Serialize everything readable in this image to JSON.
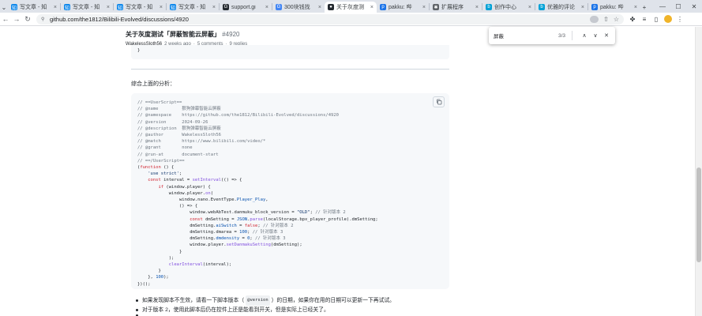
{
  "browser": {
    "tabs": [
      {
        "label": "写文章 - 知",
        "color": "#0f88eb",
        "glyph": "知"
      },
      {
        "label": "写文章 - 知",
        "color": "#0f88eb",
        "glyph": "知"
      },
      {
        "label": "写文章 - 知",
        "color": "#0f88eb",
        "glyph": "知"
      },
      {
        "label": "写文章 - 知",
        "color": "#0f88eb",
        "glyph": "知"
      },
      {
        "label": "support.gi",
        "color": "#24292f",
        "glyph": "G"
      },
      {
        "label": "300块钱找",
        "color": "#4285f4",
        "glyph": "G"
      },
      {
        "label": "关于灰度测",
        "color": "#24292f",
        "glyph": "●"
      },
      {
        "label": "pakku: 哔",
        "color": "#1a73e8",
        "glyph": "p"
      },
      {
        "label": "扩展程序",
        "color": "#5f6368",
        "glyph": "✱"
      },
      {
        "label": "创作中心",
        "color": "#00a1d6",
        "glyph": "b"
      },
      {
        "label": "优雅的评论",
        "color": "#00a1d6",
        "glyph": "b"
      },
      {
        "label": "pakku: 哔",
        "color": "#1a73e8",
        "glyph": "p"
      }
    ],
    "url": "github.com/the1812/Bilibili-Evolved/discussions/4920"
  },
  "discussion": {
    "title": "关于灰度测试「屏蔽智能云屏蔽」",
    "number": "#4920",
    "author": "WakelessSloth56",
    "time": "2 weeks ago",
    "comments": "5 comments",
    "replies": "9 replies",
    "prev_code_end": "}",
    "analysis_text": "综合上面的分析：",
    "code_lines": [
      [
        [
          "c-cm",
          "// ==UserScript=="
        ]
      ],
      [
        [
          "c-cm",
          "// @name         狠狗弹幕智能云屏蔽"
        ]
      ],
      [
        [
          "c-cm",
          "// @namespace    https://github.com/the1812/Bilibili-Evolved/discussions/4920"
        ]
      ],
      [
        [
          "c-cm",
          "// @version      2024-09-26"
        ]
      ],
      [
        [
          "c-cm",
          "// @description  狠狗弹幕智能云屏蔽"
        ]
      ],
      [
        [
          "c-cm",
          "// @author       WakelessSloth56"
        ]
      ],
      [
        [
          "c-cm",
          "// @match        https://www.bilibili.com/video/*"
        ]
      ],
      [
        [
          "c-cm",
          "// @grant        none"
        ]
      ],
      [
        [
          "c-cm",
          "// @run-at       document-start"
        ]
      ],
      [
        [
          "c-cm",
          "// ==/UserScript=="
        ]
      ],
      [
        [
          "",
          "("
        ],
        [
          "c-kw",
          "function"
        ],
        [
          "",
          " () {"
        ]
      ],
      [
        [
          "",
          "    "
        ],
        [
          "c-str",
          "'use strict'"
        ],
        [
          "",
          ";"
        ]
      ],
      [
        [
          "",
          "    "
        ],
        [
          "c-kw",
          "const"
        ],
        [
          "",
          " interval = "
        ],
        [
          "c-fn",
          "setInterval"
        ],
        [
          "",
          "(() => {"
        ]
      ],
      [
        [
          "",
          "        "
        ],
        [
          "c-kw",
          "if"
        ],
        [
          "",
          " (window.player) {"
        ]
      ],
      [
        [
          "",
          "            window.player."
        ],
        [
          "c-fn",
          "on"
        ],
        [
          "",
          "("
        ]
      ],
      [
        [
          "",
          "                window.nano.EventType."
        ],
        [
          "c-prop",
          "Player_Play"
        ],
        [
          "",
          ","
        ]
      ],
      [
        [
          "",
          "                () => {"
        ]
      ],
      [
        [
          "",
          "                    window.webAbTest.danmuku_block_version = "
        ],
        [
          "c-str",
          "\"OLD\""
        ],
        [
          "",
          "; "
        ],
        [
          "c-cm",
          "// 针对版本 2"
        ]
      ],
      [
        [
          "",
          "                    "
        ],
        [
          "c-kw",
          "const"
        ],
        [
          "",
          " dmSetting = "
        ],
        [
          "c-prop",
          "JSON"
        ],
        [
          "",
          "."
        ],
        [
          "c-fn",
          "parse"
        ],
        [
          "",
          "(localStorage.bpx_player_profile).dmSetting;"
        ]
      ],
      [
        [
          "",
          "                    dmSetting."
        ],
        [
          "c-prop",
          "aiSwitch"
        ],
        [
          "",
          " = "
        ],
        [
          "c-kw",
          "false"
        ],
        [
          "",
          "; "
        ],
        [
          "c-cm",
          "// 针对版本 2"
        ]
      ],
      [
        [
          "",
          "                    dmSetting.dmarea = "
        ],
        [
          "c-prop",
          "100"
        ],
        [
          "",
          "; "
        ],
        [
          "c-cm",
          "// 针对版本 3"
        ]
      ],
      [
        [
          "",
          "                    dmSetting."
        ],
        [
          "c-prop",
          "dmdensity"
        ],
        [
          "",
          " = "
        ],
        [
          "c-prop",
          "0"
        ],
        [
          "",
          "; "
        ],
        [
          "c-cm",
          "// 针对版本 3"
        ]
      ],
      [
        [
          "",
          "                    window.player."
        ],
        [
          "c-fn",
          "setDanmakuSetting"
        ],
        [
          "",
          "(dmSetting);"
        ]
      ],
      [
        [
          "",
          "                }"
        ]
      ],
      [
        [
          "",
          "            );"
        ]
      ],
      [
        [
          "",
          "            "
        ],
        [
          "c-fn",
          "clearInterval"
        ],
        [
          "",
          "(interval);"
        ]
      ],
      [
        [
          "",
          "        }"
        ]
      ],
      [
        [
          "",
          "    }, "
        ],
        [
          "c-prop",
          "100"
        ],
        [
          "",
          ");"
        ]
      ],
      [
        [
          "",
          "})();"
        ]
      ]
    ],
    "bullets": [
      {
        "pre": "如果发现脚本不生效，请看一下脚本版本（",
        "code": "@version",
        "post": "）的日期，如果你在用的日期可以更新一下再试试。"
      },
      {
        "pre": "对于版本 2，使用此脚本后仍在控件上还是能看到开关，但是实际上已经关了。",
        "code": "",
        "post": ""
      },
      {
        "pre": "",
        "code": "",
        "post": ""
      }
    ]
  },
  "findbar": {
    "query": "屏蔽",
    "count": "3/3"
  }
}
